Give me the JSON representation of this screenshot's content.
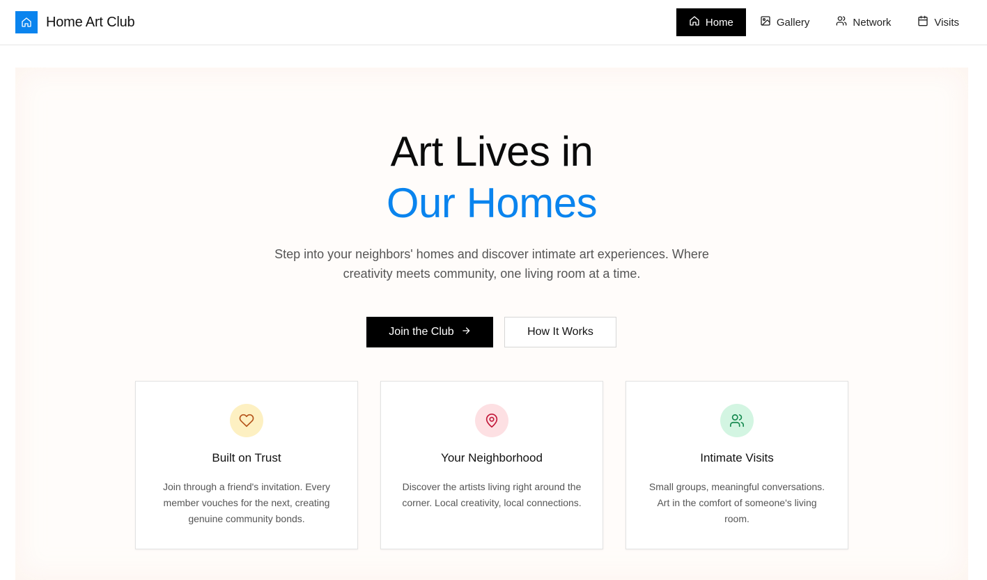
{
  "header": {
    "brand_name": "Home Art Club",
    "brand_icon": "home-icon",
    "nav": [
      {
        "label": "Home",
        "icon": "home-icon",
        "active": true
      },
      {
        "label": "Gallery",
        "icon": "image-icon",
        "active": false
      },
      {
        "label": "Network",
        "icon": "users-icon",
        "active": false
      },
      {
        "label": "Visits",
        "icon": "calendar-icon",
        "active": false
      }
    ]
  },
  "hero": {
    "headline_line1": "Art Lives in",
    "headline_line2": "Our Homes",
    "subtitle": "Step into your neighbors' homes and discover intimate art experiences. Where creativity meets community, one living room at a time.",
    "primary_button": "Join the Club",
    "secondary_button": "How It Works"
  },
  "features": [
    {
      "title": "Built on Trust",
      "text": "Join through a friend's invitation. Every member vouches for the next, creating genuine community bonds.",
      "icon": "heart-icon",
      "icon_bg": "#fdf0c2",
      "icon_color": "#b4531a"
    },
    {
      "title": "Your Neighborhood",
      "text": "Discover the artists living right around the corner. Local creativity, local connections.",
      "icon": "map-pin-icon",
      "icon_bg": "#fde0e3",
      "icon_color": "#c2183a"
    },
    {
      "title": "Intimate Visits",
      "text": "Small groups, meaningful conversations. Art in the comfort of someone's living room.",
      "icon": "users-icon",
      "icon_bg": "#d3f5e2",
      "icon_color": "#14884e"
    }
  ],
  "colors": {
    "accent": "#0a84ee",
    "primary_button": "#000000"
  }
}
